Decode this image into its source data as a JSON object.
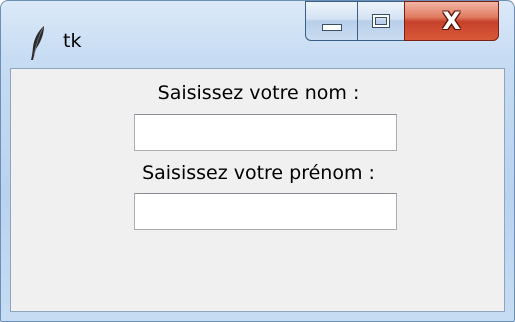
{
  "window": {
    "title": "tk",
    "controls": {
      "minimize": "minimize",
      "maximize": "maximize",
      "close": "X"
    }
  },
  "form": {
    "nom_label": "Saisissez votre nom :",
    "nom_value": "",
    "prenom_label": "Saisissez votre prénom :",
    "prenom_value": ""
  },
  "icons": {
    "app": "feather-icon",
    "minimize": "minimize-icon",
    "maximize": "maximize-icon",
    "close": "close-icon"
  },
  "colors": {
    "client_bg": "#f0f0f0",
    "close_button": "#c6412a",
    "titlebar": "#c7dcf3"
  }
}
